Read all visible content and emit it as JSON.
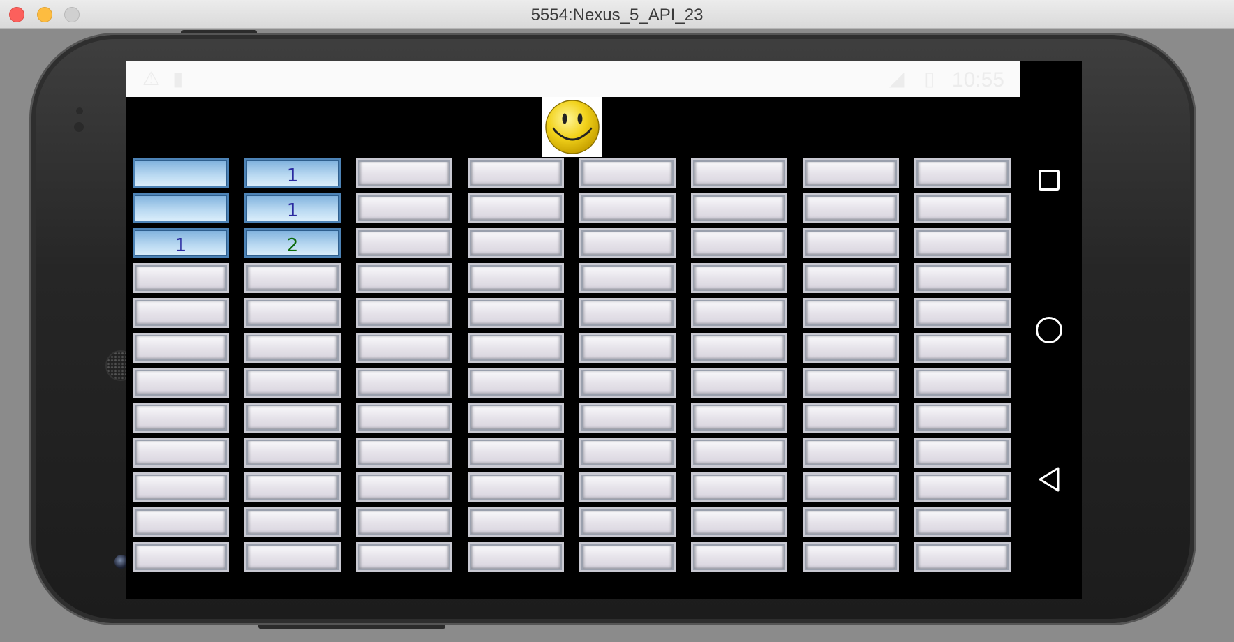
{
  "window": {
    "title": "5554:Nexus_5_API_23"
  },
  "status_bar": {
    "time": "10:55"
  },
  "game": {
    "face": "smiley-face",
    "grid": [
      [
        "",
        "1",
        "",
        "",
        "",
        "",
        "",
        ""
      ],
      [
        "",
        "1",
        "",
        "",
        "",
        "",
        "",
        ""
      ],
      [
        "1",
        "2",
        "",
        "",
        "",
        "",
        "",
        ""
      ],
      [
        "",
        "",
        "",
        "",
        "",
        "",
        "",
        ""
      ],
      [
        "",
        "",
        "",
        "",
        "",
        "",
        "",
        ""
      ],
      [
        "",
        "",
        "",
        "",
        "",
        "",
        "",
        ""
      ],
      [
        "",
        "",
        "",
        "",
        "",
        "",
        "",
        ""
      ],
      [
        "",
        "",
        "",
        "",
        "",
        "",
        "",
        ""
      ],
      [
        "",
        "",
        "",
        "",
        "",
        "",
        "",
        ""
      ],
      [
        "",
        "",
        "",
        "",
        "",
        "",
        "",
        ""
      ],
      [
        "",
        "",
        "",
        "",
        "",
        "",
        "",
        ""
      ],
      [
        "",
        "",
        "",
        "",
        "",
        "",
        "",
        ""
      ]
    ],
    "revealed": [
      [
        true,
        true,
        false,
        false,
        false,
        false,
        false,
        false
      ],
      [
        true,
        true,
        false,
        false,
        false,
        false,
        false,
        false
      ],
      [
        true,
        true,
        false,
        false,
        false,
        false,
        false,
        false
      ],
      [
        false,
        false,
        false,
        false,
        false,
        false,
        false,
        false
      ],
      [
        false,
        false,
        false,
        false,
        false,
        false,
        false,
        false
      ],
      [
        false,
        false,
        false,
        false,
        false,
        false,
        false,
        false
      ],
      [
        false,
        false,
        false,
        false,
        false,
        false,
        false,
        false
      ],
      [
        false,
        false,
        false,
        false,
        false,
        false,
        false,
        false
      ],
      [
        false,
        false,
        false,
        false,
        false,
        false,
        false,
        false
      ],
      [
        false,
        false,
        false,
        false,
        false,
        false,
        false,
        false
      ],
      [
        false,
        false,
        false,
        false,
        false,
        false,
        false,
        false
      ],
      [
        false,
        false,
        false,
        false,
        false,
        false,
        false,
        false
      ]
    ]
  },
  "colors": {
    "number_1": "#2a2aa0",
    "number_2": "#0b6a0b",
    "revealed_tile": "#b8d8f1"
  },
  "icons": {
    "status_left": [
      "warning-icon",
      "sd-card-icon"
    ],
    "status_right": [
      "no-signal-icon",
      "battery-icon"
    ],
    "nav": [
      "recents-icon",
      "home-icon",
      "back-icon"
    ]
  }
}
